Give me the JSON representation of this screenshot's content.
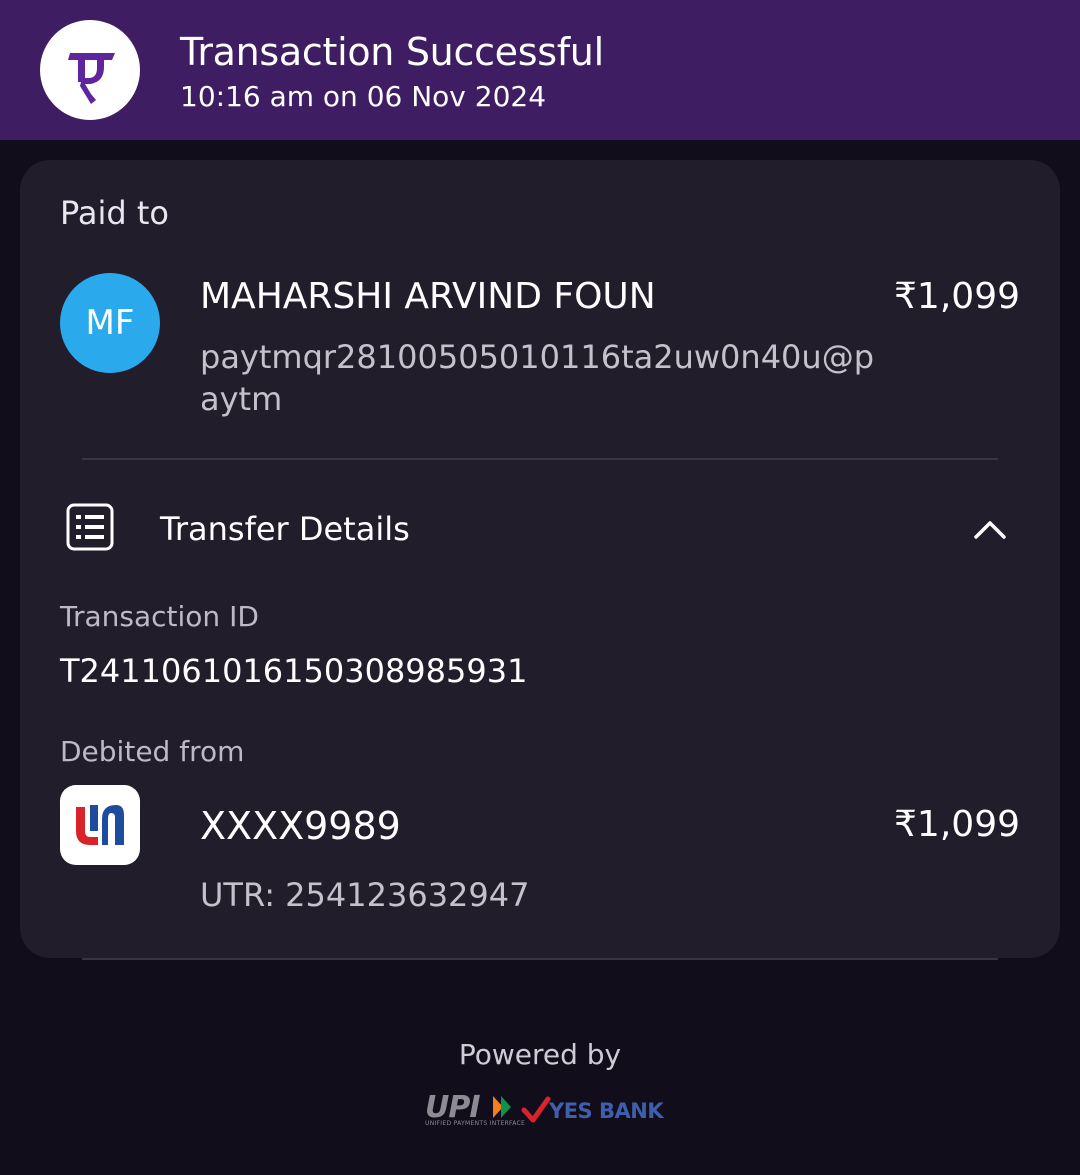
{
  "header": {
    "title": "Transaction Successful",
    "timestamp": "10:16 am on 06 Nov 2024",
    "logo_icon": "phonepe-logo-icon",
    "background": "#3f1d63"
  },
  "paid_to": {
    "label": "Paid to",
    "avatar_initials": "MF",
    "avatar_color": "#2aa9ec",
    "name": "MAHARSHI ARVIND FOUN",
    "vpa": "paytmqr28100505010116ta2uw0n40u@paytm",
    "amount": "₹1,099"
  },
  "transfer_details": {
    "title": "Transfer Details",
    "icon": "document-list-icon",
    "toggle_icon": "chevron-up-icon",
    "transaction_id_label": "Transaction ID",
    "transaction_id": "T2411061016150308985931",
    "debited_from_label": "Debited from",
    "bank_icon": "union-bank-logo-icon",
    "account": "XXXX9989",
    "amount": "₹1,099",
    "utr": "UTR: 254123632947"
  },
  "footer": {
    "powered_by": "Powered by",
    "upi_logo_text": "UPI",
    "upi_logo_subtext": "UNIFIED PAYMENTS INTERFACE",
    "bank_logo_text": "YES BANK"
  }
}
